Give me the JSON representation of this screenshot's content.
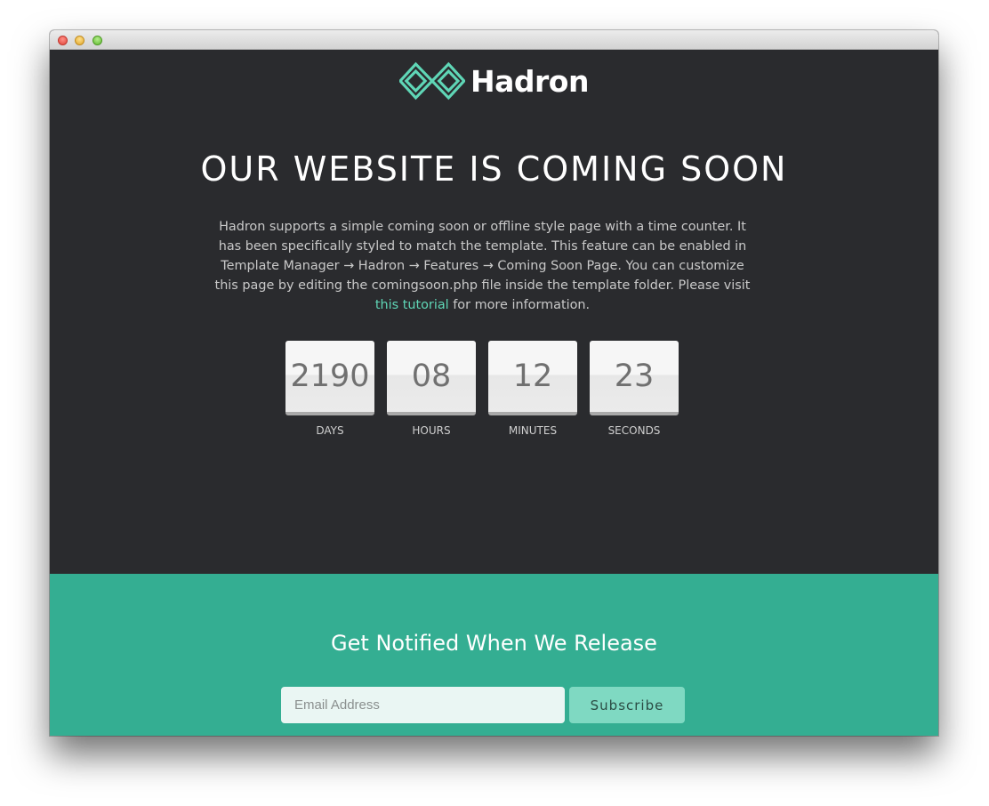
{
  "brand": {
    "name": "Hadron",
    "accent_color": "#5fd6b6"
  },
  "hero": {
    "headline": "OUR WEBSITE IS COMING SOON",
    "description_text": "Hadron supports a simple coming soon or offline style page with a time counter. It has been specifically styled to match the template. This feature can be enabled in Template Manager → Hadron → Features → Coming Soon Page. You can customize this page by editing the comingsoon.php file inside the template folder. Please visit ",
    "link_text": "this tutorial",
    "description_suffix": " for more information."
  },
  "countdown": [
    {
      "value": "2190",
      "label": "DAYS"
    },
    {
      "value": "08",
      "label": "HOURS"
    },
    {
      "value": "12",
      "label": "MINUTES"
    },
    {
      "value": "23",
      "label": "SECONDS"
    }
  ],
  "notify": {
    "title": "Get Notified When We Release",
    "email_placeholder": "Email Address",
    "email_value": "",
    "subscribe_label": "Subscribe",
    "background_color": "#34ae92"
  }
}
